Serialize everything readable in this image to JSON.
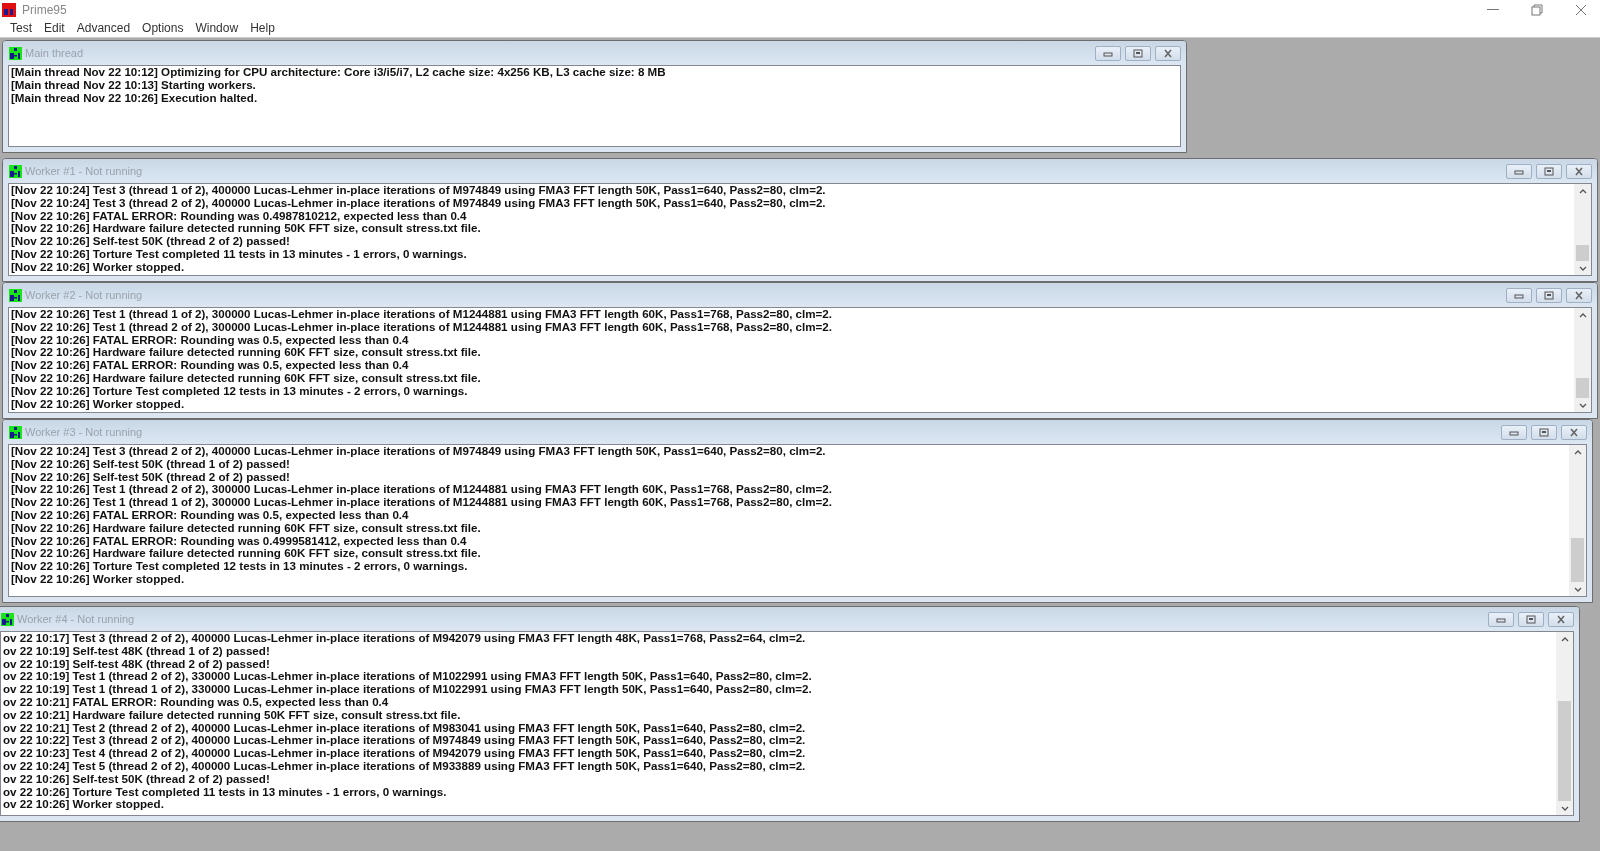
{
  "app": {
    "title": "Prime95"
  },
  "menu": [
    "Test",
    "Edit",
    "Advanced",
    "Options",
    "Window",
    "Help"
  ],
  "windows": [
    {
      "title": "Main thread",
      "scrollbar": false,
      "lines": [
        "[Main thread Nov 22 10:12] Optimizing for CPU architecture: Core i3/i5/i7, L2 cache size: 4x256 KB, L3 cache size: 8 MB",
        "[Main thread Nov 22 10:13] Starting workers.",
        "[Main thread Nov 22 10:26] Execution halted."
      ]
    },
    {
      "title": "Worker #1 - Not running",
      "scrollbar": true,
      "lines": [
        "[Nov 22 10:24] Test 3 (thread 1 of 2), 400000 Lucas-Lehmer in-place iterations of M974849 using FMA3 FFT length 50K, Pass1=640, Pass2=80, clm=2.",
        "[Nov 22 10:24] Test 3 (thread 2 of 2), 400000 Lucas-Lehmer in-place iterations of M974849 using FMA3 FFT length 50K, Pass1=640, Pass2=80, clm=2.",
        "[Nov 22 10:26] FATAL ERROR: Rounding was 0.4987810212, expected less than 0.4",
        "[Nov 22 10:26] Hardware failure detected running 50K FFT size, consult stress.txt file.",
        "[Nov 22 10:26] Self-test 50K (thread 2 of 2) passed!",
        "[Nov 22 10:26] Torture Test completed 11 tests in 13 minutes - 1 errors, 0 warnings.",
        "[Nov 22 10:26] Worker stopped."
      ]
    },
    {
      "title": "Worker #2 - Not running",
      "scrollbar": true,
      "lines": [
        "[Nov 22 10:26] Test 1 (thread 1 of 2), 300000 Lucas-Lehmer in-place iterations of M1244881 using FMA3 FFT length 60K, Pass1=768, Pass2=80, clm=2.",
        "[Nov 22 10:26] Test 1 (thread 2 of 2), 300000 Lucas-Lehmer in-place iterations of M1244881 using FMA3 FFT length 60K, Pass1=768, Pass2=80, clm=2.",
        "[Nov 22 10:26] FATAL ERROR: Rounding was 0.5, expected less than 0.4",
        "[Nov 22 10:26] Hardware failure detected running 60K FFT size, consult stress.txt file.",
        "[Nov 22 10:26] FATAL ERROR: Rounding was 0.5, expected less than 0.4",
        "[Nov 22 10:26] Hardware failure detected running 60K FFT size, consult stress.txt file.",
        "[Nov 22 10:26] Torture Test completed 12 tests in 13 minutes - 2 errors, 0 warnings.",
        "[Nov 22 10:26] Worker stopped."
      ]
    },
    {
      "title": "Worker #3 - Not running",
      "scrollbar": true,
      "lines": [
        "[Nov 22 10:24] Test 3 (thread 2 of 2), 400000 Lucas-Lehmer in-place iterations of M974849 using FMA3 FFT length 50K, Pass1=640, Pass2=80, clm=2.",
        "[Nov 22 10:26] Self-test 50K (thread 1 of 2) passed!",
        "[Nov 22 10:26] Self-test 50K (thread 2 of 2) passed!",
        "[Nov 22 10:26] Test 1 (thread 2 of 2), 300000 Lucas-Lehmer in-place iterations of M1244881 using FMA3 FFT length 60K, Pass1=768, Pass2=80, clm=2.",
        "[Nov 22 10:26] Test 1 (thread 1 of 2), 300000 Lucas-Lehmer in-place iterations of M1244881 using FMA3 FFT length 60K, Pass1=768, Pass2=80, clm=2.",
        "[Nov 22 10:26] FATAL ERROR: Rounding was 0.5, expected less than 0.4",
        "[Nov 22 10:26] Hardware failure detected running 60K FFT size, consult stress.txt file.",
        "[Nov 22 10:26] FATAL ERROR: Rounding was 0.4999581412, expected less than 0.4",
        "[Nov 22 10:26] Hardware failure detected running 60K FFT size, consult stress.txt file.",
        "[Nov 22 10:26] Torture Test completed 12 tests in 13 minutes - 2 errors, 0 warnings.",
        "[Nov 22 10:26] Worker stopped."
      ]
    },
    {
      "title": "Worker #4 - Not running",
      "scrollbar": true,
      "lines": [
        "ov 22 10:17] Test 3 (thread 2 of 2), 400000 Lucas-Lehmer in-place iterations of M942079 using FMA3 FFT length 48K, Pass1=768, Pass2=64, clm=2.",
        "ov 22 10:19] Self-test 48K (thread 1 of 2) passed!",
        "ov 22 10:19] Self-test 48K (thread 2 of 2) passed!",
        "ov 22 10:19] Test 1 (thread 2 of 2), 330000 Lucas-Lehmer in-place iterations of M1022991 using FMA3 FFT length 50K, Pass1=640, Pass2=80, clm=2.",
        "ov 22 10:19] Test 1 (thread 1 of 2), 330000 Lucas-Lehmer in-place iterations of M1022991 using FMA3 FFT length 50K, Pass1=640, Pass2=80, clm=2.",
        "ov 22 10:21] FATAL ERROR: Rounding was 0.5, expected less than 0.4",
        "ov 22 10:21] Hardware failure detected running 50K FFT size, consult stress.txt file.",
        "ov 22 10:21] Test 2 (thread 2 of 2), 400000 Lucas-Lehmer in-place iterations of M983041 using FMA3 FFT length 50K, Pass1=640, Pass2=80, clm=2.",
        "ov 22 10:22] Test 3 (thread 2 of 2), 400000 Lucas-Lehmer in-place iterations of M974849 using FMA3 FFT length 50K, Pass1=640, Pass2=80, clm=2.",
        "ov 22 10:23] Test 4 (thread 2 of 2), 400000 Lucas-Lehmer in-place iterations of M942079 using FMA3 FFT length 50K, Pass1=640, Pass2=80, clm=2.",
        "ov 22 10:24] Test 5 (thread 2 of 2), 400000 Lucas-Lehmer in-place iterations of M933889 using FMA3 FFT length 50K, Pass1=640, Pass2=80, clm=2.",
        "ov 22 10:26] Self-test 50K (thread 2 of 2) passed!",
        "ov 22 10:26] Torture Test completed 11 tests in 13 minutes - 1 errors, 0 warnings.",
        "ov 22 10:26] Worker stopped."
      ]
    }
  ]
}
